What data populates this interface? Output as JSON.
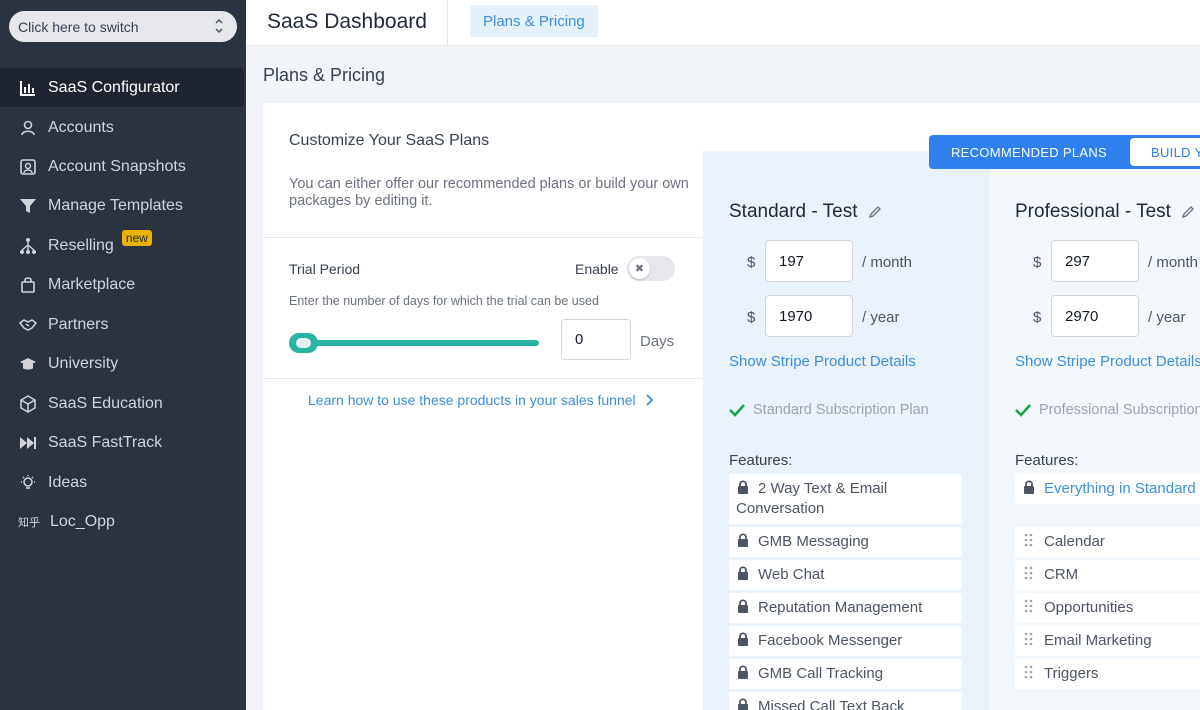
{
  "sidebar": {
    "switcher_label": "Click here to switch",
    "items": [
      {
        "label": "SaaS Configurator",
        "icon": "bar-chart-icon",
        "active": true
      },
      {
        "label": "Accounts",
        "icon": "user-icon"
      },
      {
        "label": "Account Snapshots",
        "icon": "snapshot-icon"
      },
      {
        "label": "Manage Templates",
        "icon": "filter-icon"
      },
      {
        "label": "Reselling",
        "icon": "network-icon",
        "badge": "new"
      },
      {
        "label": "Marketplace",
        "icon": "shopping-bag-icon"
      },
      {
        "label": "Partners",
        "icon": "handshake-icon"
      },
      {
        "label": "University",
        "icon": "graduation-cap-icon"
      },
      {
        "label": "SaaS Education",
        "icon": "cube-icon"
      },
      {
        "label": "SaaS FastTrack",
        "icon": "fast-forward-icon"
      },
      {
        "label": "Ideas",
        "icon": "lightbulb-icon"
      },
      {
        "label": "Loc_Opp",
        "icon": "zhihu-icon",
        "icon_text": "知乎"
      }
    ]
  },
  "header": {
    "title": "SaaS Dashboard",
    "tab": "Plans & Pricing"
  },
  "page_title": "Plans & Pricing",
  "customize": {
    "title": "Customize Your SaaS Plans",
    "description": "You can either offer our recommended plans or build your own packages by editing it.",
    "trial_label": "Trial Period",
    "enable_label": "Enable",
    "toggle_glyph": "✖",
    "trial_help": "Enter the number of days for which the trial can be used",
    "days_value": "0",
    "days_label": "Days",
    "slider_level": 0,
    "learn_link": "Learn how to use these products in your sales funnel"
  },
  "plan_toggle": {
    "recommended": "RECOMMENDED PLANS",
    "build": "BUILD YOUR OWN"
  },
  "plans": {
    "standard": {
      "name": "Standard - Test",
      "currency": "$",
      "monthly": "197",
      "monthly_period": "/ month",
      "yearly": "1970",
      "yearly_period": "/ year",
      "stripe_link": "Show Stripe Product Details",
      "subscription": "Standard Subscription Plan",
      "features_label": "Features:",
      "features": [
        "2 Way Text & Email Conversation",
        "GMB Messaging",
        "Web Chat",
        "Reputation Management",
        "Facebook Messenger",
        "GMB Call Tracking",
        "Missed Call Text Back"
      ]
    },
    "professional": {
      "name": "Professional - Test",
      "currency": "$",
      "monthly": "297",
      "monthly_period": "/ month",
      "yearly": "2970",
      "yearly_period": "/ year",
      "stripe_link": "Show Stripe Product Details",
      "subscription": "Professional Subscription Plan",
      "features_label": "Features:",
      "everything": "Everything in Standard - Test +",
      "features": [
        "Calendar",
        "CRM",
        "Opportunities",
        "Email Marketing",
        "Triggers"
      ]
    }
  },
  "colors": {
    "sidebar_bg": "#2b3340",
    "accent": "#2f80ed",
    "link": "#3b8fd9",
    "slider": "#2bb3a3",
    "badge": "#eab308",
    "check": "#16a34a"
  }
}
